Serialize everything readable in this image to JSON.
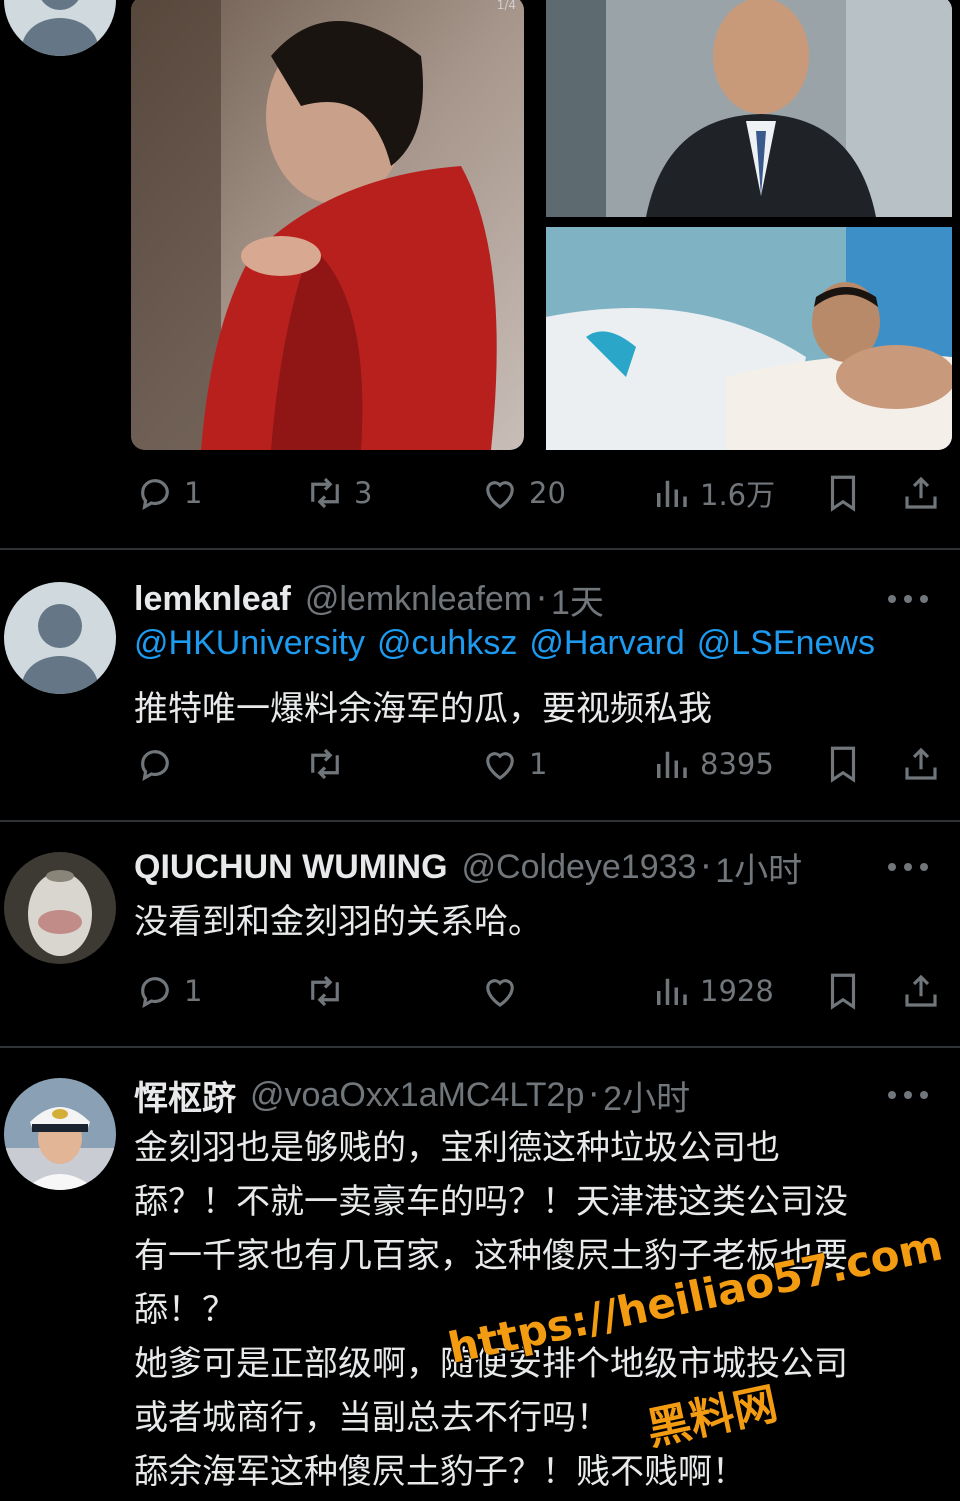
{
  "media_badge": "1/4",
  "tweets": [
    {
      "actions": {
        "reply": "1",
        "repost": "3",
        "like": "20",
        "views": "1.6万"
      }
    },
    {
      "display_name": "lemknleaf",
      "handle": "@lemknleafem",
      "separator": "·",
      "time": "1天",
      "mentions": [
        "@HKUniversity",
        "@cuhksz",
        "@Harvard",
        "@LSEnews"
      ],
      "text_lines": [
        "推特唯一爆料余海军的瓜，要视频私我"
      ],
      "actions": {
        "reply": "",
        "repost": "",
        "like": "1",
        "views": "8395"
      }
    },
    {
      "display_name": "QIUCHUN WUMING",
      "handle": "@Coldeye1933",
      "separator": "·",
      "time": "1小时",
      "text_lines": [
        "没看到和金刻羽的关系哈。"
      ],
      "actions": {
        "reply": "1",
        "repost": "",
        "like": "",
        "views": "1928"
      }
    },
    {
      "display_name": "恽枢跻",
      "handle": "@voaOxx1aMC4LT2p",
      "separator": "·",
      "time": "2小时",
      "text_lines": [
        "金刻羽也是够贱的，宝利德这种垃圾公司也",
        "舔？！不就一卖豪车的吗？！天津港这类公司没",
        "有一千家也有几百家，这种傻屄土豹子老板也要",
        "舔！？",
        "她爹可是正部级啊，随便安排个地级市城投公司",
        "或者城商行，当副总去不行吗！",
        "舔余海军这种傻屄土豹子？！贱不贱啊！"
      ]
    }
  ],
  "watermark": {
    "url": "https://heiliao57.com",
    "name": "黑料网"
  },
  "colors": {
    "background": "#000000",
    "text": "#e7e9ea",
    "muted": "#71767b",
    "link": "#1d9bf0",
    "divider": "#2f3336",
    "watermark": "#f39c12"
  }
}
